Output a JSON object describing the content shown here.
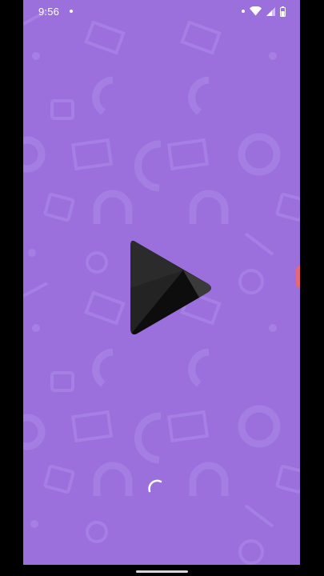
{
  "status_bar": {
    "time": "9:56",
    "icons": [
      "notification-dot-icon",
      "wifi-icon",
      "cellular-signal-icon",
      "battery-icon"
    ]
  },
  "splash": {
    "logo_icon": "google-play-movies-logo-icon",
    "background_color": "#9b70dd",
    "loading_indicator": "spinner-icon"
  },
  "colors": {
    "background": "#9b70dd",
    "pattern": "#a47de2",
    "logo_dark": "#232323",
    "logo_light": "#3a3a3a",
    "edge_handle": "#e8657b"
  }
}
